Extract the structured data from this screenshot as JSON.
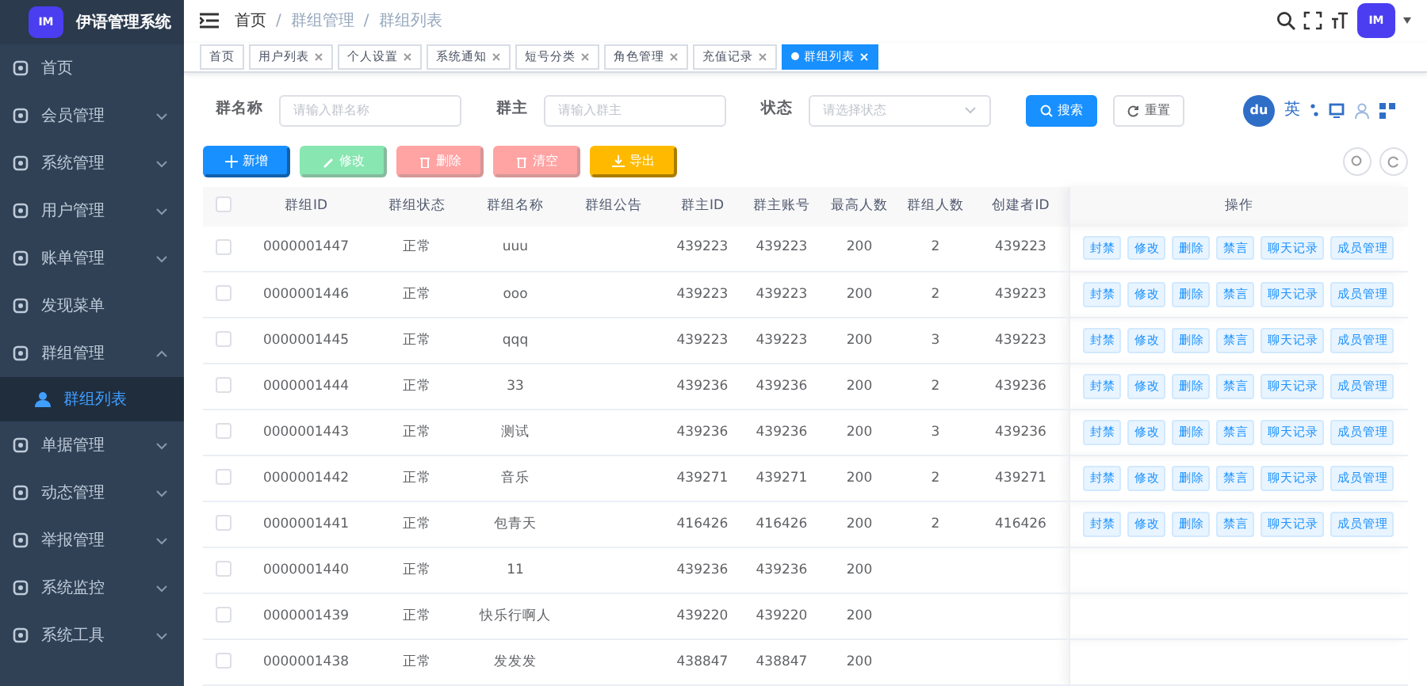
{
  "app": {
    "title": "伊语管理系统",
    "logo_text": "IM"
  },
  "sidebar": {
    "items": [
      {
        "label": "首页"
      },
      {
        "label": "会员管理",
        "expanded": false
      },
      {
        "label": "系统管理",
        "expanded": false
      },
      {
        "label": "用户管理",
        "expanded": false
      },
      {
        "label": "账单管理",
        "expanded": false
      },
      {
        "label": "发现菜单"
      },
      {
        "label": "群组管理",
        "expanded": true,
        "children": [
          {
            "label": "群组列表",
            "selected": true
          }
        ]
      },
      {
        "label": "单据管理",
        "expanded": false
      },
      {
        "label": "动态管理",
        "expanded": false
      },
      {
        "label": "举报管理",
        "expanded": false
      },
      {
        "label": "系统监控",
        "expanded": false
      },
      {
        "label": "系统工具",
        "expanded": false
      }
    ]
  },
  "breadcrumb": [
    "首页",
    "群组管理",
    "群组列表"
  ],
  "breadcrumb_separator": "/",
  "header": {
    "avatar_text": "IM"
  },
  "tags": [
    {
      "label": "首页",
      "closable": false,
      "selected": false
    },
    {
      "label": "用户列表",
      "closable": true,
      "selected": false
    },
    {
      "label": "个人设置",
      "closable": true,
      "selected": false
    },
    {
      "label": "系统通知",
      "closable": true,
      "selected": false
    },
    {
      "label": "短号分类",
      "closable": true,
      "selected": false
    },
    {
      "label": "角色管理",
      "closable": true,
      "selected": false
    },
    {
      "label": "充值记录",
      "closable": true,
      "selected": false
    },
    {
      "label": "群组列表",
      "closable": true,
      "selected": true
    }
  ],
  "search_form": {
    "fields": [
      {
        "label": "群名称",
        "placeholder": "请输入群名称",
        "kind": "input"
      },
      {
        "label": "群主",
        "placeholder": "请输入群主",
        "kind": "input"
      },
      {
        "label": "状态",
        "placeholder": "请选择状态",
        "kind": "select"
      }
    ],
    "search_button": "搜索",
    "reset_button": "重置"
  },
  "ime_toolbar": {
    "logo": "du",
    "mode": "英"
  },
  "toolbar": [
    {
      "label": "新增",
      "kind": "primary",
      "disabled": false
    },
    {
      "label": "修改",
      "kind": "success",
      "disabled": true
    },
    {
      "label": "删除",
      "kind": "danger",
      "disabled": true
    },
    {
      "label": "清空",
      "kind": "danger",
      "disabled": true
    },
    {
      "label": "导出",
      "kind": "warning",
      "disabled": false
    }
  ],
  "table": {
    "select_all_checked": false,
    "columns": [
      "群组ID",
      "群组状态",
      "群组名称",
      "群组公告",
      "群主ID",
      "群主账号",
      "最高人数",
      "群组人数",
      "创建者ID",
      "操作"
    ],
    "rows": [
      {
        "checked": false,
        "cells": [
          "0000001447",
          "正常",
          "uuu",
          null,
          "439223",
          "439223",
          "200",
          "2",
          "439223"
        ],
        "actions": [
          "封禁",
          "修改",
          "删除",
          "禁言",
          "聊天记录",
          "成员管理"
        ]
      },
      {
        "checked": false,
        "cells": [
          "0000001446",
          "正常",
          "ooo",
          null,
          "439223",
          "439223",
          "200",
          "2",
          "439223"
        ],
        "actions": [
          "封禁",
          "修改",
          "删除",
          "禁言",
          "聊天记录",
          "成员管理"
        ]
      },
      {
        "checked": false,
        "cells": [
          "0000001445",
          "正常",
          "qqq",
          null,
          "439223",
          "439223",
          "200",
          "3",
          "439223"
        ],
        "actions": [
          "封禁",
          "修改",
          "删除",
          "禁言",
          "聊天记录",
          "成员管理"
        ]
      },
      {
        "checked": false,
        "cells": [
          "0000001444",
          "正常",
          "33",
          null,
          "439236",
          "439236",
          "200",
          "2",
          "439236"
        ],
        "actions": [
          "封禁",
          "修改",
          "删除",
          "禁言",
          "聊天记录",
          "成员管理"
        ]
      },
      {
        "checked": false,
        "cells": [
          "0000001443",
          "正常",
          "测试",
          null,
          "439236",
          "439236",
          "200",
          "3",
          "439236"
        ],
        "actions": [
          "封禁",
          "修改",
          "删除",
          "禁言",
          "聊天记录",
          "成员管理"
        ]
      },
      {
        "checked": false,
        "cells": [
          "0000001442",
          "正常",
          "音乐",
          null,
          "439271",
          "439271",
          "200",
          "2",
          "439271"
        ],
        "actions": [
          "封禁",
          "修改",
          "删除",
          "禁言",
          "聊天记录",
          "成员管理"
        ]
      },
      {
        "checked": false,
        "cells": [
          "0000001441",
          "正常",
          "包青天",
          null,
          "416426",
          "416426",
          "200",
          "2",
          "416426"
        ],
        "actions": [
          "封禁",
          "修改",
          "删除",
          "禁言",
          "聊天记录",
          "成员管理"
        ]
      },
      {
        "checked": false,
        "cells": [
          "0000001440",
          "正常",
          "11",
          null,
          "439236",
          "439236",
          "200"
        ]
      },
      {
        "checked": false,
        "cells": [
          "0000001439",
          "正常",
          "快乐行啊人",
          null,
          "439220",
          "439220",
          "200"
        ]
      },
      {
        "checked": false,
        "cells": [
          "0000001438",
          "正常",
          "发发发",
          null,
          "438847",
          "438847",
          "200"
        ]
      }
    ]
  }
}
